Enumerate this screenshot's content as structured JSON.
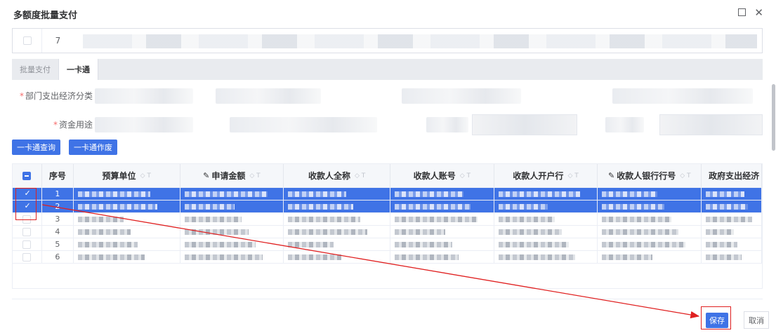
{
  "dialog": {
    "title": "多额度批量支付"
  },
  "top_row": {
    "index": "7"
  },
  "tabs": [
    {
      "label": "批量支付",
      "active": false
    },
    {
      "label": "一卡通",
      "active": true
    }
  ],
  "form": {
    "dept_econ_label": "部门支出经济分类",
    "fund_use_label": "资金用途"
  },
  "buttons": {
    "query": "一卡通查询",
    "void": "一卡通作废",
    "save": "保存",
    "cancel": "取消"
  },
  "table": {
    "columns": [
      {
        "label": "序号",
        "sortable": false,
        "editable": false
      },
      {
        "label": "预算单位",
        "sortable": true,
        "editable": false
      },
      {
        "label": "申请金额",
        "sortable": true,
        "editable": true
      },
      {
        "label": "收款人全称",
        "sortable": true,
        "editable": false
      },
      {
        "label": "收款人账号",
        "sortable": true,
        "editable": false
      },
      {
        "label": "收款人开户行",
        "sortable": true,
        "editable": false
      },
      {
        "label": "收款人银行行号",
        "sortable": true,
        "editable": true
      },
      {
        "label": "政府支出经济",
        "sortable": false,
        "editable": false
      }
    ],
    "rows": [
      {
        "index": "1",
        "selected": true
      },
      {
        "index": "2",
        "selected": true
      },
      {
        "index": "3",
        "selected": false
      },
      {
        "index": "4",
        "selected": false
      },
      {
        "index": "5",
        "selected": false
      },
      {
        "index": "6",
        "selected": false
      }
    ]
  },
  "icons": {
    "sort": "sort-icon",
    "filter": "filter-icon",
    "edit": "edit-icon",
    "maximize": "maximize-icon",
    "close": "close-icon"
  },
  "colors": {
    "primary": "#3f73e6",
    "selected_row": "#3f73e6",
    "annotation": "#e02020",
    "required": "#f56c6c"
  }
}
